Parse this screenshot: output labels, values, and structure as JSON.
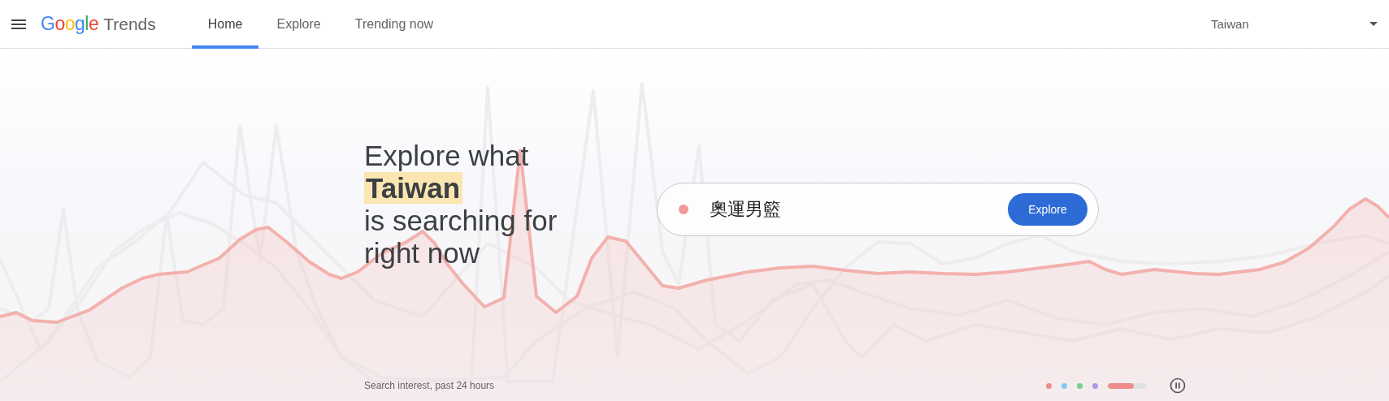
{
  "header": {
    "brand": {
      "logo": "Google",
      "product": "Trends"
    },
    "tabs": [
      {
        "label": "Home",
        "selected": true
      },
      {
        "label": "Explore",
        "selected": false
      },
      {
        "label": "Trending now",
        "selected": false
      }
    ],
    "region": {
      "value": "Taiwan"
    }
  },
  "hero": {
    "headline": {
      "before": "Explore what",
      "highlight": "Taiwan",
      "after_1": "is searching for",
      "after_2": "right now"
    },
    "search": {
      "dot": {
        "color": "#ef9a9a"
      },
      "query": "奧運男籃",
      "button": "Explore"
    },
    "caption": "Search interest, past 24 hours",
    "carousel": {
      "dots": [
        {
          "color": "#ef8c8c"
        },
        {
          "color": "#81c9f5"
        },
        {
          "color": "#6fd28c"
        },
        {
          "color": "#a99ae8"
        }
      ],
      "progress": {
        "level": 0.67,
        "color": "#ef8c8c"
      }
    }
  }
}
